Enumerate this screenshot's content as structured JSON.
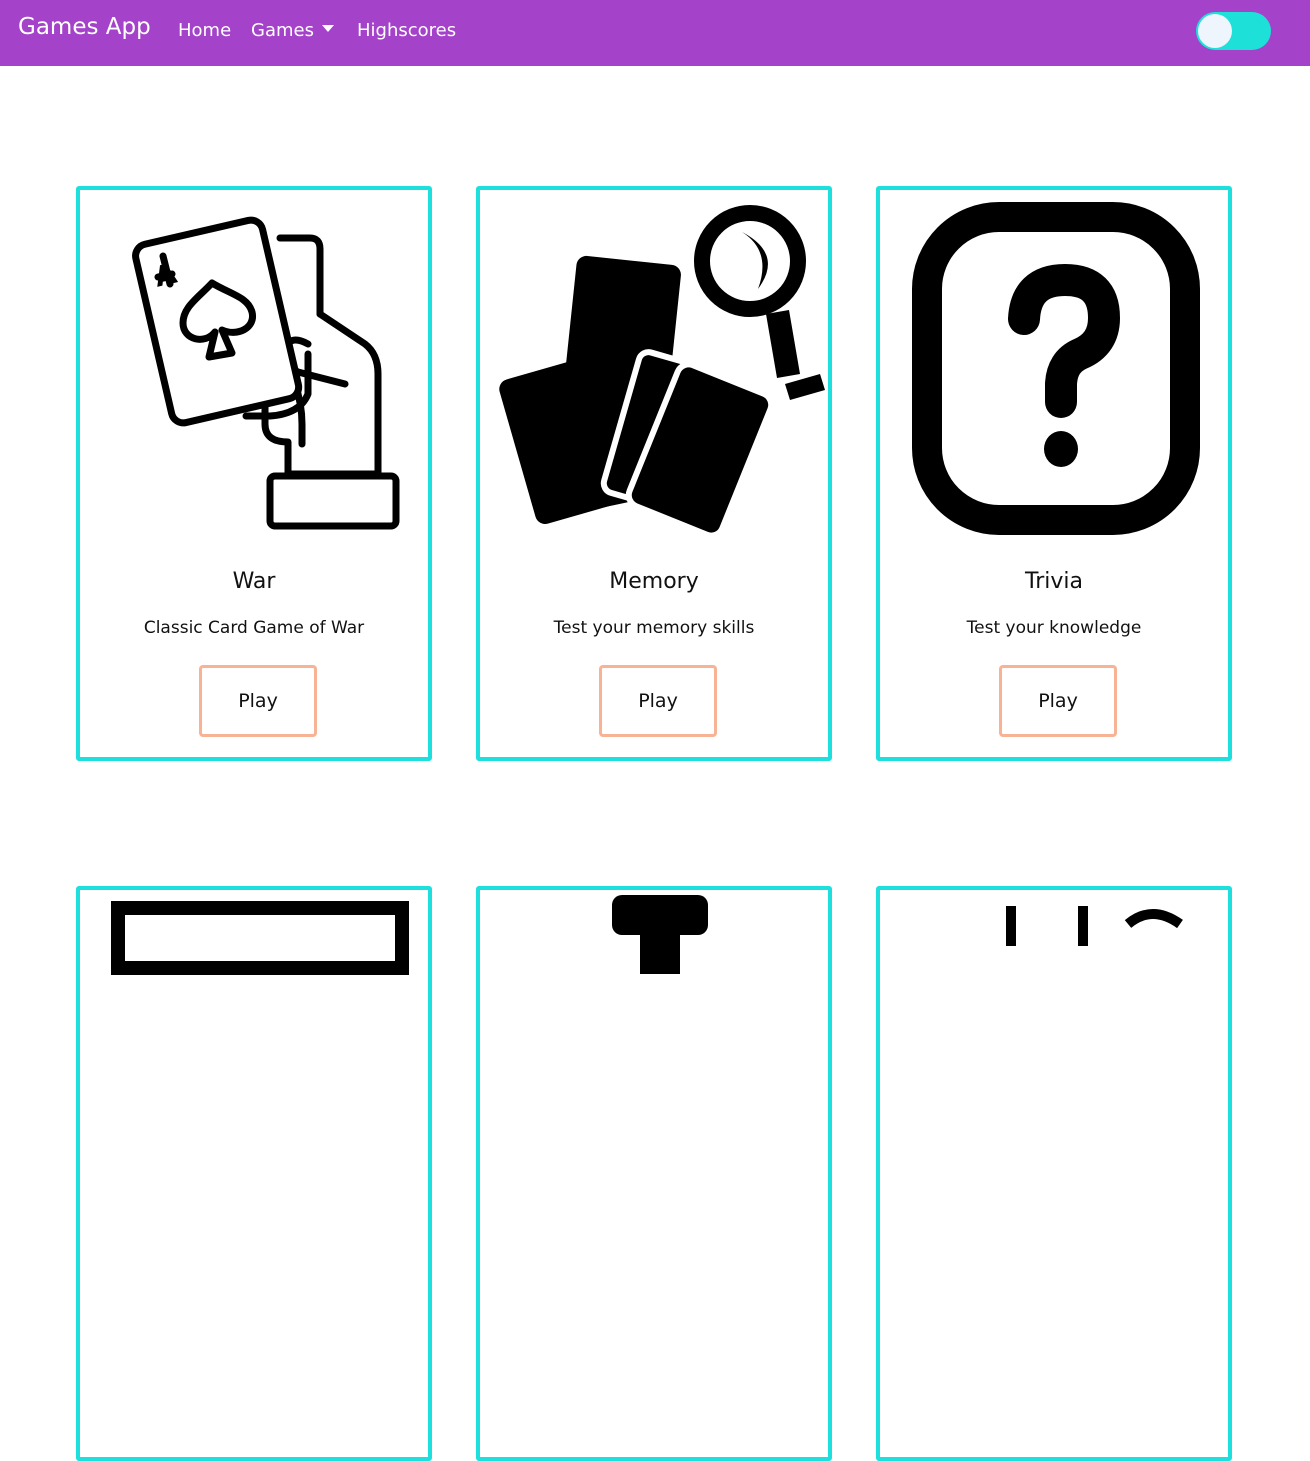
{
  "navbar": {
    "brand": "Games App",
    "links": [
      {
        "label": "Home"
      },
      {
        "label": "Games"
      },
      {
        "label": "Highscores"
      }
    ],
    "toggle": {
      "state": "off",
      "colors": {
        "track": "#1de0d8",
        "knob": "#eef5fd"
      }
    }
  },
  "theme": {
    "navbar_bg": "#a442c9",
    "card_border": "#1de0de",
    "button_border": "#f7b394"
  },
  "cards": [
    {
      "title": "War",
      "description": "Classic Card Game of War",
      "button": "Play",
      "icon": "hand-holding-ace-of-spades-icon"
    },
    {
      "title": "Memory",
      "description": "Test your memory skills",
      "button": "Play",
      "icon": "cards-with-magnifying-glass-icon"
    },
    {
      "title": "Trivia",
      "description": "Test your knowledge",
      "button": "Play",
      "icon": "question-mark-box-icon"
    }
  ],
  "partial_cards": [
    {
      "icon": "partial-icon"
    },
    {
      "icon": "partial-icon"
    },
    {
      "icon": "partial-icon"
    }
  ]
}
